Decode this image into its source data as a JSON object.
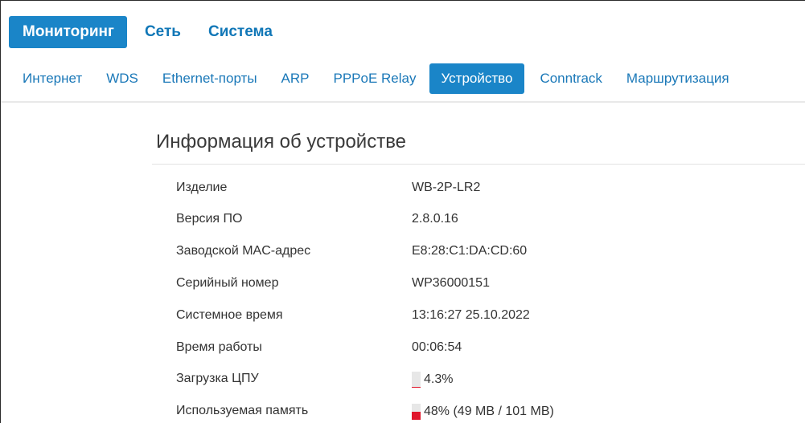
{
  "top_nav": {
    "tabs": [
      {
        "label": "Мониторинг",
        "active": true
      },
      {
        "label": "Сеть",
        "active": false
      },
      {
        "label": "Система",
        "active": false
      }
    ]
  },
  "sub_nav": {
    "tabs": [
      {
        "label": "Интернет",
        "active": false
      },
      {
        "label": "WDS",
        "active": false
      },
      {
        "label": "Ethernet-порты",
        "active": false
      },
      {
        "label": "ARP",
        "active": false
      },
      {
        "label": "PPPoE Relay",
        "active": false
      },
      {
        "label": "Устройство",
        "active": true
      },
      {
        "label": "Conntrack",
        "active": false
      },
      {
        "label": "Маршрутизация",
        "active": false
      }
    ]
  },
  "device_info": {
    "title": "Информация об устройстве",
    "rows": [
      {
        "label": "Изделие",
        "value": "WB-2P-LR2"
      },
      {
        "label": "Версия ПО",
        "value": "2.8.0.16"
      },
      {
        "label": "Заводской MAC-адрес",
        "value": "E8:28:C1:DA:CD:60"
      },
      {
        "label": "Серийный номер",
        "value": "WP36000151"
      },
      {
        "label": "Системное время",
        "value": "13:16:27 25.10.2022"
      },
      {
        "label": "Время работы",
        "value": "00:06:54"
      },
      {
        "label": "Загрузка ЦПУ",
        "value": "4.3%",
        "meter_fraction": 0.043
      },
      {
        "label": "Используемая память",
        "value": "48% (49 MB / 101 MB)",
        "meter_fraction": 0.48
      }
    ]
  },
  "colors": {
    "accent": "#1a85c8",
    "link": "#1a78b8",
    "meter_fill": "#e0162b",
    "meter_track": "#e7e7e7"
  }
}
